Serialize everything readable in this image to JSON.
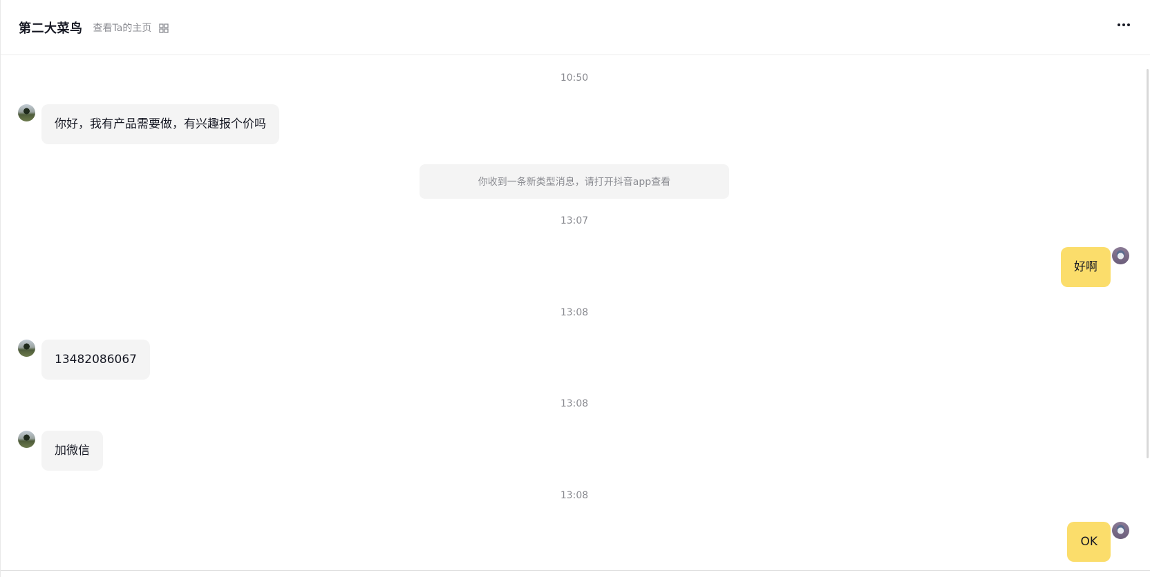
{
  "header": {
    "contact_name": "第二大菜鸟",
    "profile_link": "查看Ta的主页",
    "qr_icon": "qr-code-icon",
    "more_icon": "more-horizontal-icon"
  },
  "messages": [
    {
      "type": "time",
      "text": "10:50"
    },
    {
      "type": "peer",
      "text": "你好，我有产品需要做，有兴趣报个价吗"
    },
    {
      "type": "notice",
      "text": "你收到一条新类型消息，请打开抖音app查看"
    },
    {
      "type": "time",
      "text": "13:07"
    },
    {
      "type": "self",
      "text": "好啊"
    },
    {
      "type": "time",
      "text": "13:08"
    },
    {
      "type": "peer",
      "text": "13482086067"
    },
    {
      "type": "time",
      "text": "13:08"
    },
    {
      "type": "peer",
      "text": "加微信"
    },
    {
      "type": "time",
      "text": "13:08"
    },
    {
      "type": "self",
      "text": "OK"
    }
  ],
  "colors": {
    "self_bubble": "#fbdd6b",
    "peer_bubble": "#f4f4f4",
    "muted_text": "#8a8b91"
  }
}
